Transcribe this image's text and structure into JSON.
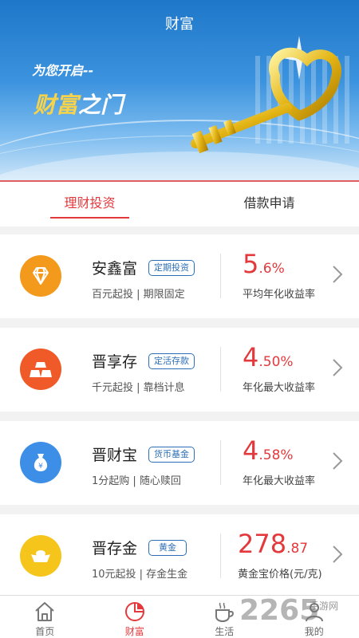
{
  "header": {
    "title": "财富",
    "tagline": "为您开启--",
    "slogan_part1": "财富",
    "slogan_part2": "之门"
  },
  "tabs": [
    {
      "label": "理财投资",
      "active": true
    },
    {
      "label": "借款申请",
      "active": false
    }
  ],
  "products": [
    {
      "name": "安鑫富",
      "badge": "定期投资",
      "features": "百元起投  |  期限固定",
      "rate_big": "5",
      "rate_small": ".6%",
      "rate_label": "平均年化收益率",
      "icon": "diamond-icon",
      "color": "#f39a1c"
    },
    {
      "name": "晋享存",
      "badge": "定活存款",
      "features": "千元起投  |  靠档计息",
      "rate_big": "4",
      "rate_small": ".50%",
      "rate_label": "年化最大收益率",
      "icon": "gold-bars-icon",
      "color": "#f05a28"
    },
    {
      "name": "晋财宝",
      "badge": "货币基金",
      "features": "1分起购  |  随心赎回",
      "rate_big": "4",
      "rate_small": ".58%",
      "rate_label": "年化最大收益率",
      "icon": "money-bag-icon",
      "color": "#3d8ee6"
    },
    {
      "name": "晋存金",
      "badge": "黄金",
      "features": "10元起投  |  存金生金",
      "rate_big": "278",
      "rate_small": ".87",
      "rate_label": "黄金宝价格(元/克)",
      "icon": "gold-ingot-icon",
      "color": "#f6c51b"
    }
  ],
  "bottom_nav": [
    {
      "label": "首页",
      "icon": "home-icon",
      "active": false
    },
    {
      "label": "财富",
      "icon": "pie-chart-icon",
      "active": true
    },
    {
      "label": "生活",
      "icon": "coffee-cup-icon",
      "active": false
    },
    {
      "label": "我的",
      "icon": "user-icon",
      "active": false
    }
  ],
  "watermark": {
    "number": "2265",
    "site": "手游网"
  },
  "colors": {
    "accent": "#e4393c",
    "badge_blue": "#2d6fb6"
  }
}
